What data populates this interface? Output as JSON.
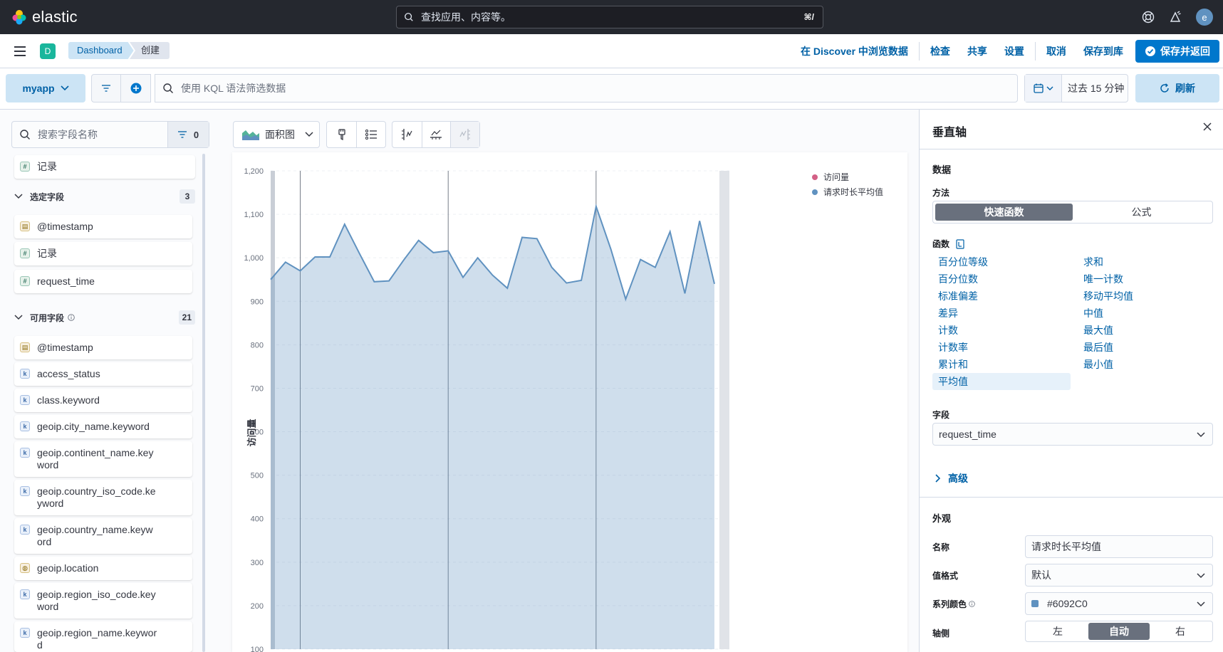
{
  "header": {
    "brand": "elastic",
    "search_placeholder": "查找应用、内容等。",
    "shortcut": "⌘/",
    "user_initial": "e"
  },
  "nav": {
    "space_initial": "D",
    "breadcrumbs": [
      "Dashboard",
      "创建"
    ],
    "links": [
      "在 Discover 中浏览数据",
      "检查",
      "共享",
      "设置",
      "取消",
      "保存到库"
    ],
    "save_return": "保存并返回"
  },
  "query": {
    "dataview": "myapp",
    "kql_placeholder": "使用 KQL 语法筛选数据",
    "time_range": "过去 15 分钟",
    "refresh": "刷新"
  },
  "fields": {
    "search_placeholder": "搜索字段名称",
    "filter_count": "0",
    "records": "记录",
    "selected_title": "选定字段",
    "selected_count": "3",
    "selected": [
      "@timestamp",
      "记录",
      "request_time"
    ],
    "available_title": "可用字段",
    "available_count": "21",
    "available": [
      "@timestamp",
      "access_status",
      "class.keyword",
      "geoip.city_name.keyword",
      "geoip.continent_name.keyword",
      "geoip.country_iso_code.keyword",
      "geoip.country_name.keyword",
      "geoip.location",
      "geoip.region_iso_code.keyword",
      "geoip.region_name.keyword"
    ]
  },
  "toolbar": {
    "chart_type": "面积图"
  },
  "chart_data": {
    "type": "area",
    "ylabel": "访问量",
    "yticks": [
      100,
      200,
      300,
      400,
      500,
      600,
      700,
      800,
      900,
      1000,
      1100,
      1200
    ],
    "ytick_labels": [
      "100",
      "200",
      "300",
      "400",
      "500",
      "600",
      "700",
      "800",
      "900",
      "1,000",
      "1,100",
      "1,200"
    ],
    "ylim": [
      100,
      1200
    ],
    "legend": [
      "访问量",
      "请求时长平均值"
    ],
    "legend_colors": [
      "#d36086",
      "#6092c0"
    ],
    "series": [
      {
        "name": "请求时长平均值",
        "color": "#6092c0",
        "values": [
          950,
          990,
          970,
          1002,
          1002,
          1077,
          1010,
          945,
          947,
          995,
          1040,
          1012,
          1016,
          955,
          1000,
          960,
          930,
          1047,
          1044,
          978,
          942,
          948,
          1118,
          1020,
          905,
          996,
          978,
          1060,
          918,
          1085,
          940
        ]
      }
    ]
  },
  "panel": {
    "title": "垂直轴",
    "data_title": "数据",
    "method_label": "方法",
    "method_options": [
      "快速函数",
      "公式"
    ],
    "function_label": "函数",
    "functions_left": [
      "百分位等级",
      "百分位数",
      "标准偏差",
      "差异",
      "计数",
      "计数率",
      "累计和",
      "平均值"
    ],
    "functions_right": [
      "求和",
      "唯一计数",
      "移动平均值",
      "中值",
      "最大值",
      "最后值",
      "最小值"
    ],
    "field_label": "字段",
    "field_value": "request_time",
    "advanced": "高级",
    "appearance_title": "外观",
    "name_label": "名称",
    "name_value": "请求时长平均值",
    "format_label": "值格式",
    "format_value": "默认",
    "color_label": "系列颜色",
    "color_value": "#6092C0",
    "axis_label": "轴侧",
    "axis_options": [
      "左",
      "自动",
      "右"
    ]
  }
}
